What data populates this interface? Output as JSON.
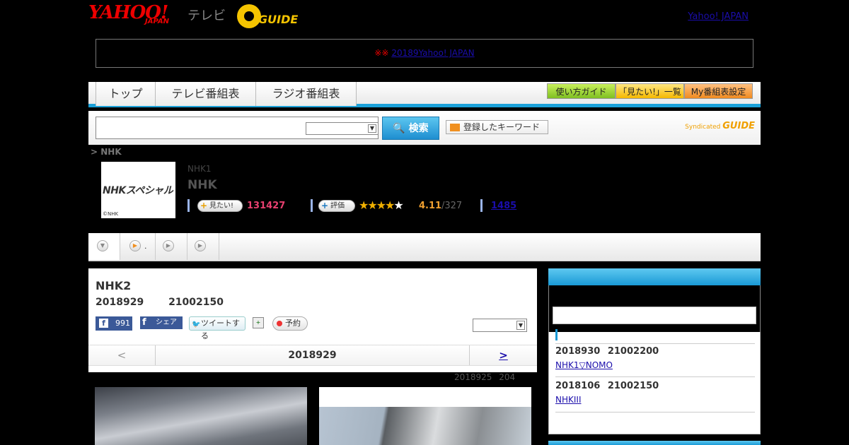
{
  "header": {
    "logo_yahoo": "YAHOO!",
    "logo_japan": "JAPAN",
    "logo_tv": "テレビ",
    "logo_gguide": "GUIDE",
    "yj_link": "Yahoo! JAPAN"
  },
  "notice": {
    "mark": "※※",
    "link": "20189Yahoo! JAPAN"
  },
  "nav": {
    "tabs": [
      "トップ",
      "テレビ番組表",
      "ラジオ番組表"
    ],
    "buttons": [
      "使い方ガイド",
      "「見たい!」一覧",
      "My番組表設定"
    ]
  },
  "search": {
    "button": "検索",
    "keyword_button": "登録したキーワード",
    "syndicated": "Syndicated",
    "syndicated_brand": "GUIDE"
  },
  "breadcrumb": "> NHK",
  "program": {
    "thumb_logo": "NHKスペシャル",
    "thumb_copy": "©NHK",
    "channel": "NHK1",
    "title": "NHK",
    "want_label": "見たい!",
    "want_count": "131427",
    "rate_label": "評価",
    "stars": 4,
    "rating": "4.11",
    "rating_count": "/327",
    "review_count": "1485"
  },
  "tabs2": {
    "dot": "."
  },
  "main": {
    "title": "NHK2",
    "date": "2018929 21002150",
    "fb_count": "991",
    "fb_share": "シェア",
    "tweet": "ツイートする",
    "reserve": "予約",
    "pager_prev": "<",
    "pager_current": "2018929",
    "pager_next": ">",
    "updated": "2018925 204"
  },
  "side": {
    "items": [
      {
        "date": "2018930 21002200",
        "link": "NHK1▽NOMO"
      },
      {
        "date": "2018106 21002150",
        "link": "NHKIII"
      }
    ]
  }
}
